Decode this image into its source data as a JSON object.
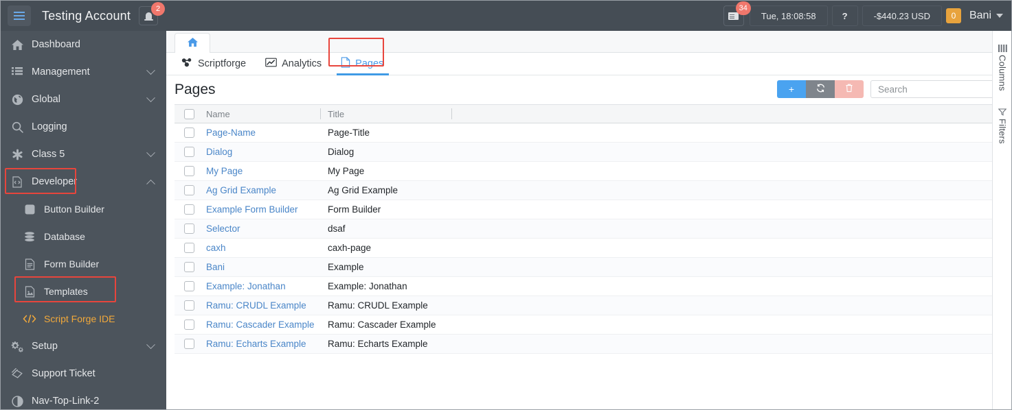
{
  "topbar": {
    "hamburger_icon": "hamburger-menu-icon",
    "account_title": "Testing Account",
    "bell_icon": "bell-icon",
    "bell_badge": "2",
    "doc_icon": "document-list-icon",
    "doc_badge": "34",
    "time": "Tue, 18:08:58",
    "help": "?",
    "balance": "-$440.23 USD",
    "count_badge": "0",
    "user": "Bani",
    "caret_icon": "chevron-down-icon"
  },
  "sidebar": {
    "items": [
      {
        "label": "Dashboard",
        "icon": "home-icon",
        "expandable": false,
        "sub": false
      },
      {
        "label": "Management",
        "icon": "list-icon",
        "expandable": true,
        "sub": false
      },
      {
        "label": "Global",
        "icon": "globe-icon",
        "expandable": true,
        "sub": false
      },
      {
        "label": "Logging",
        "icon": "search-icon",
        "expandable": false,
        "sub": false
      },
      {
        "label": "Class 5",
        "icon": "asterisk-icon",
        "expandable": true,
        "sub": false
      },
      {
        "label": "Developer",
        "icon": "code-file-icon",
        "expandable": true,
        "sub": false,
        "highlighted": true,
        "expanded": true
      },
      {
        "label": "Button Builder",
        "icon": "square-icon",
        "expandable": false,
        "sub": true
      },
      {
        "label": "Database",
        "icon": "database-icon",
        "expandable": false,
        "sub": true
      },
      {
        "label": "Form Builder",
        "icon": "document-icon",
        "expandable": false,
        "sub": true
      },
      {
        "label": "Templates",
        "icon": "image-document-icon",
        "expandable": false,
        "sub": true
      },
      {
        "label": "Script Forge IDE",
        "icon": "code-brackets-icon",
        "expandable": false,
        "sub": true,
        "active": true,
        "highlighted": true
      },
      {
        "label": "Setup",
        "icon": "gears-icon",
        "expandable": true,
        "sub": false
      },
      {
        "label": "Support Ticket",
        "icon": "ticket-icon",
        "expandable": false,
        "sub": false
      },
      {
        "label": "Nav-Top-Link-2",
        "icon": "half-circle-icon",
        "expandable": false,
        "sub": false
      }
    ]
  },
  "tabs": {
    "home_icon": "home-icon",
    "subtabs": [
      {
        "label": "Scriptforge",
        "icon": "blocks-icon",
        "active": false
      },
      {
        "label": "Analytics",
        "icon": "chart-line-icon",
        "active": false
      },
      {
        "label": "Pages",
        "icon": "file-icon",
        "active": true,
        "highlighted": true
      }
    ]
  },
  "page": {
    "title": "Pages",
    "toolbar": {
      "add_label": "+",
      "add_icon": "plus-icon",
      "refresh_icon": "refresh-icon",
      "delete_icon": "trash-icon"
    },
    "search": {
      "placeholder": "Search",
      "value": ""
    }
  },
  "grid": {
    "columns": [
      "Name",
      "Title"
    ],
    "select_all_icon": "checkbox-icon",
    "rows": [
      {
        "name": "Page-Name",
        "title": "Page-Title"
      },
      {
        "name": "Dialog",
        "title": "Dialog"
      },
      {
        "name": "My Page",
        "title": "My Page"
      },
      {
        "name": "Ag Grid Example",
        "title": "Ag Grid Example"
      },
      {
        "name": "Example Form Builder",
        "title": "Form Builder"
      },
      {
        "name": "Selector",
        "title": "dsaf"
      },
      {
        "name": "caxh",
        "title": "caxh-page"
      },
      {
        "name": "Bani",
        "title": "Example"
      },
      {
        "name": "Example: Jonathan",
        "title": "Example: Jonathan"
      },
      {
        "name": "Ramu: CRUDL Example",
        "title": "Ramu: CRUDL Example"
      },
      {
        "name": "Ramu: Cascader Example",
        "title": "Ramu: Cascader Example"
      },
      {
        "name": "Ramu: Echarts Example",
        "title": "Ramu: Echarts Example"
      }
    ]
  },
  "rail": {
    "columns_label": "Columns",
    "columns_icon": "columns-icon",
    "filters_label": "Filters",
    "filters_icon": "filter-icon"
  },
  "colors": {
    "topbar_bg": "#454d55",
    "sidebar_bg": "#4c545c",
    "accent_blue": "#4a9ae8",
    "link_blue": "#4a86c8",
    "highlight_red": "#e8453c",
    "active_orange": "#f2a93b",
    "badge_red": "#f0776c",
    "badge_orange": "#e8a33d"
  }
}
